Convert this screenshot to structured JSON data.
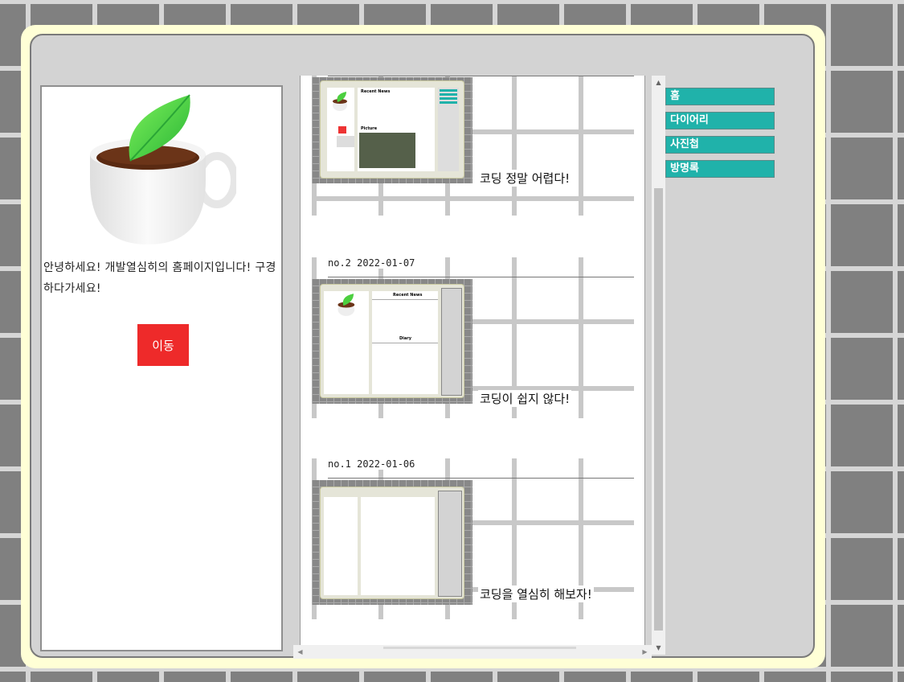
{
  "sidebar": {
    "intro": "안녕하세요! 개발열심히의 홈페이지입니다! 구경하다가세요!",
    "move_button": "이동"
  },
  "diary": {
    "entries": [
      {
        "header": "",
        "caption": "코딩 정말 어렵다!"
      },
      {
        "header": "no.2 2022-01-07",
        "caption": "코딩이 쉽지 않다!"
      },
      {
        "header": "no.1 2022-01-06",
        "caption": "코딩을 열심히 해보자!"
      }
    ],
    "thumb_labels": {
      "recent_news": "Recent News",
      "picture": "Picture",
      "diary": "Diary"
    }
  },
  "nav": {
    "items": [
      "홈",
      "다이어리",
      "사진첩",
      "방명록"
    ]
  },
  "colors": {
    "nav_bg": "#20b2aa",
    "button_bg": "#ee2a2a",
    "frame_bg": "#ffffd6",
    "panel_bg": "#d3d3d3"
  }
}
